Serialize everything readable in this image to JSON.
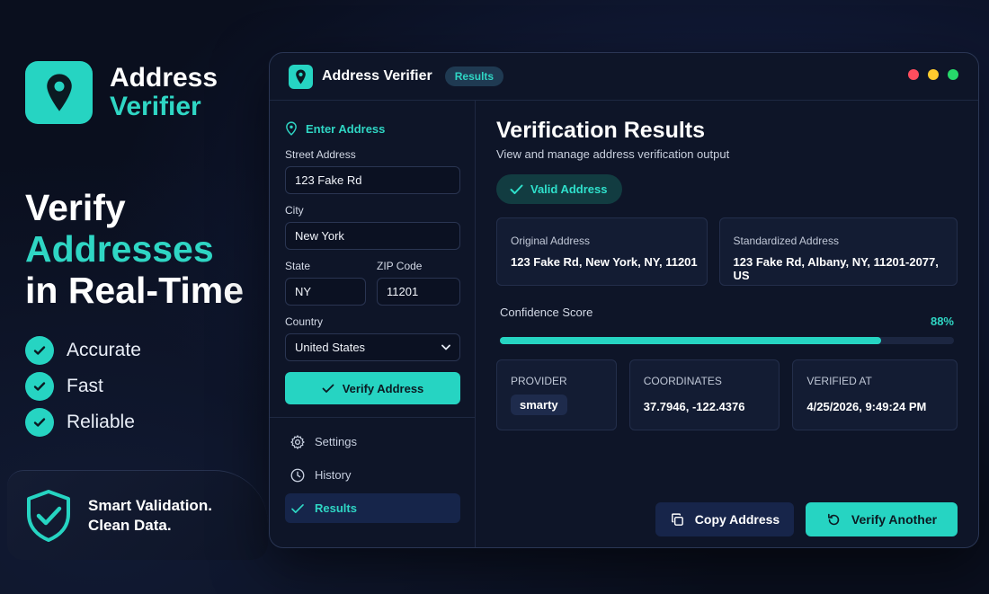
{
  "brand": {
    "line1": "Address",
    "line2": "Verifier"
  },
  "headline": {
    "line1": "Verify",
    "line2": "Addresses",
    "line3": "in Real-Time"
  },
  "features": [
    "Accurate",
    "Fast",
    "Reliable"
  ],
  "promo": {
    "line1": "Smart Validation.",
    "line2": "Clean Data."
  },
  "window": {
    "title": "Address Verifier",
    "badge": "Results",
    "dot_colors": [
      "#ff4d5e",
      "#ffcc2e",
      "#27d86a"
    ]
  },
  "form": {
    "section_title": "Enter Address",
    "street_label": "Street Address",
    "street_value": "123 Fake Rd",
    "city_label": "City",
    "city_value": "New York",
    "state_label": "State",
    "state_value": "NY",
    "zip_label": "ZIP Code",
    "zip_value": "11201",
    "country_label": "Country",
    "country_value": "United States",
    "verify_label": "Verify Address"
  },
  "nav": [
    {
      "label": "Settings",
      "icon": "gear-icon"
    },
    {
      "label": "History",
      "icon": "clock-icon"
    },
    {
      "label": "Results",
      "icon": "check-icon",
      "active": true
    }
  ],
  "results": {
    "title": "Verification Results",
    "subtitle": "View and manage address verification output",
    "status": "Valid Address",
    "original_label": "Original Address",
    "original_value": "123 Fake Rd, New York, NY, 11201",
    "standardized_label": "Standardized Address",
    "standardized_value": "123 Fake Rd, Albany, NY, 11201-2077, US",
    "confidence_label": "Confidence Score",
    "confidence_text": "88%",
    "confidence": 0.84,
    "provider_label": "PROVIDER",
    "provider_value": "smarty",
    "coords_label": "COORDINATES",
    "coords_value": "37.7946, -122.4376",
    "verified_label": "VERIFIED AT",
    "verified_value": "4/25/2026, 9:49:24 PM",
    "copy_label": "Copy Address",
    "again_label": "Verify Another"
  },
  "colors": {
    "accent": "#26d4c2",
    "accent_text": "#2fd6c4",
    "background": "#0a0f1e"
  }
}
